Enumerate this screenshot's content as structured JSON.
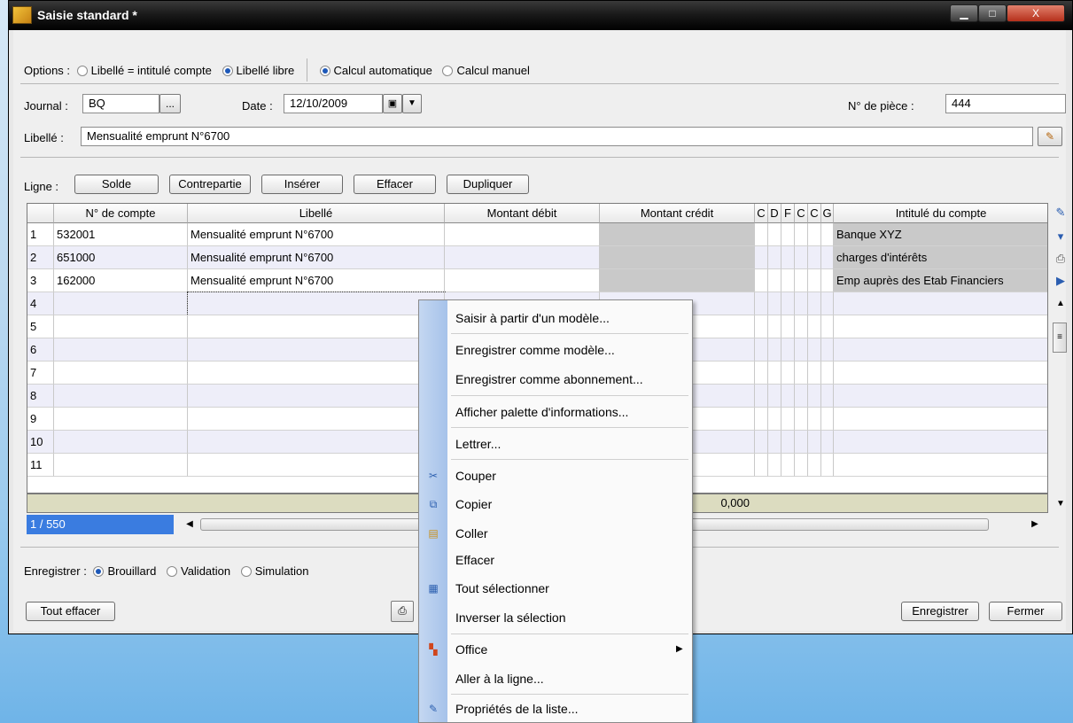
{
  "window": {
    "title": "Saisie standard *",
    "minimize_glyph": "▁",
    "maximize_glyph": "□",
    "close_glyph": "X"
  },
  "options": {
    "label": "Options :",
    "libelle_intitule": "Libellé = intitulé compte",
    "libelle_libre": "Libellé libre",
    "calcul_auto": "Calcul automatique",
    "calcul_manuel": "Calcul manuel"
  },
  "header": {
    "journal_label": "Journal :",
    "journal_value": "BQ",
    "journal_browse": "...",
    "date_label": "Date :",
    "date_value": "12/10/2009",
    "piece_label": "N° de pièce :",
    "piece_value": "444",
    "libelle_label": "Libellé :",
    "libelle_value": "Mensualité emprunt N°6700"
  },
  "ligne": {
    "label": "Ligne :",
    "buttons": [
      "Solde",
      "Contrepartie",
      "Insérer",
      "Effacer",
      "Dupliquer"
    ]
  },
  "grid": {
    "columns": [
      "N° de compte",
      "Libellé",
      "Montant débit",
      "Montant crédit",
      "C",
      "D",
      "F",
      "C",
      "C",
      "G",
      "Intitulé du compte"
    ],
    "rows": [
      {
        "num": "1",
        "compte": "532001",
        "libelle": "Mensualité emprunt N°6700",
        "intitule": "Banque XYZ"
      },
      {
        "num": "2",
        "compte": "651000",
        "libelle": "Mensualité emprunt N°6700",
        "intitule": "charges d'intérêts"
      },
      {
        "num": "3",
        "compte": "162000",
        "libelle": "Mensualité emprunt N°6700",
        "intitule": "Emp auprès des Etab Financiers"
      },
      {
        "num": "4"
      },
      {
        "num": "5"
      },
      {
        "num": "6"
      },
      {
        "num": "7"
      },
      {
        "num": "8"
      },
      {
        "num": "9"
      },
      {
        "num": "10"
      },
      {
        "num": "11"
      }
    ],
    "total_credit": "0,000",
    "position": "1 / 550"
  },
  "enregistrer": {
    "label": "Enregistrer :",
    "brouillard": "Brouillard",
    "validation": "Validation",
    "simulation": "Simulation"
  },
  "footer": {
    "tout_effacer": "Tout effacer",
    "enregistrer": "Enregistrer",
    "fermer": "Fermer"
  },
  "context_menu": {
    "items": [
      "Saisir à partir d'un modèle...",
      "Enregistrer comme modèle...",
      "Enregistrer comme abonnement...",
      "Afficher palette d'informations...",
      "Lettrer...",
      "Couper",
      "Copier",
      "Coller",
      "Effacer",
      "Tout sélectionner",
      "Inverser la sélection",
      "Office",
      "Aller à la ligne...",
      "Propriétés de la liste..."
    ],
    "submenu_arrow": "▶"
  },
  "colors": {
    "menu_strip": "#a6c2ea",
    "row_alt": "#eeeef9",
    "selection": "#3a7ce0"
  }
}
